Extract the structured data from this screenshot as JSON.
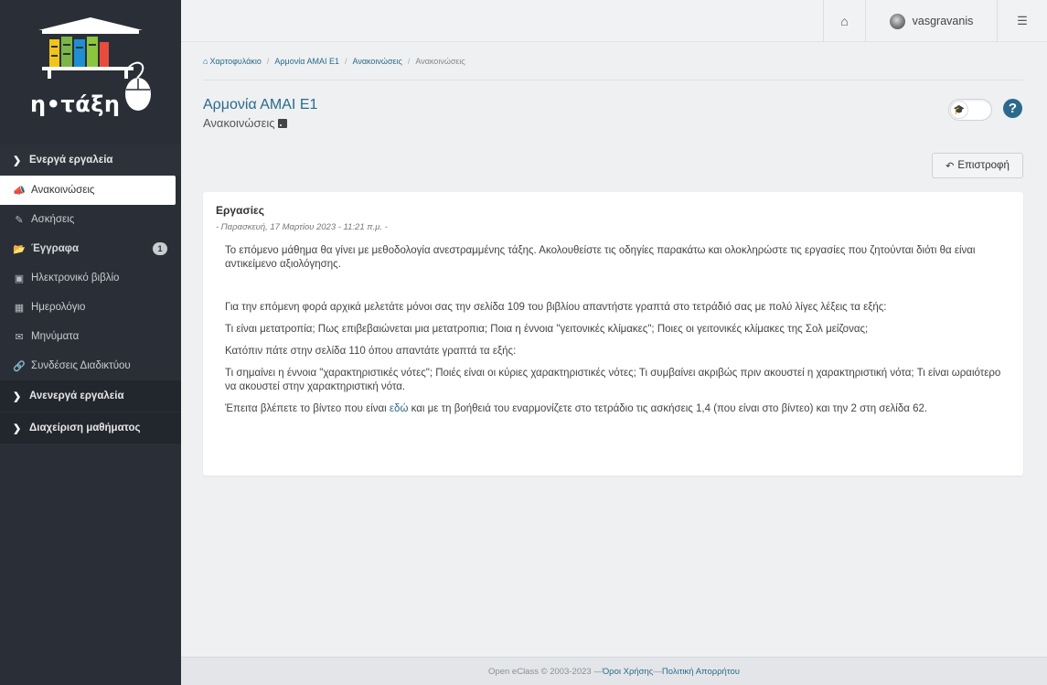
{
  "brand": {
    "logo_text": "η•τάξη"
  },
  "sidebar": {
    "active_group": "Ενεργά εργαλεία",
    "items": [
      {
        "label": "Ανακοινώσεις",
        "icon": "megaphone-icon"
      },
      {
        "label": "Ασκήσεις",
        "icon": "edit-icon"
      },
      {
        "label": "Έγγραφα",
        "icon": "folder-open-icon",
        "badge": "1"
      },
      {
        "label": "Ηλεκτρονικό βιβλίο",
        "icon": "book-icon"
      },
      {
        "label": "Ημερολόγιο",
        "icon": "calendar-icon"
      },
      {
        "label": "Μηνύματα",
        "icon": "envelope-icon"
      },
      {
        "label": "Συνδέσεις Διαδικτύου",
        "icon": "link-icon"
      }
    ],
    "inactive_group": "Ανενεργά εργαλεία",
    "admin_group": "Διαχείριση μαθήματος"
  },
  "topbar": {
    "username": "vasgravanis"
  },
  "breadcrumb": [
    "Χαρτοφυλάκιο",
    "Αρμονία ΑΜΑΙ Ε1",
    "Ανακοινώσεις",
    "Ανακοινώσεις"
  ],
  "page": {
    "title": "Αρμονία ΑΜΑΙ Ε1",
    "subtitle": "Ανακοινώσεις",
    "back_label": "Επιστροφή"
  },
  "announcement": {
    "title": "Εργασίες",
    "date": "- Παρασκευή, 17 Μαρτίου 2023 - 11:21 π.μ. -",
    "p1": "Το επόμενο μάθημα θα γίνει με μεθοδολογία ανεστραμμένης τάξης. Ακολουθείστε τις οδηγίες παρακάτω και ολοκληρώστε τις εργασίες που ζητούνται διότι θα είναι αντικείμενο αξιολόγησης.",
    "p2": "Για την επόμενη φορά αρχικά μελετάτε μόνοι σας την σελίδα 109 του βιβλίου απαντήστε γραπτά στο τετράδιό σας με πολύ λίγες λέξεις τα εξής:",
    "p3": "Τι είναι μετατροπία; Πως επιβεβαιώνεται μια μετατροπια; Ποια η έννοια \"γειτονικές κλίμακες\"; Ποιες οι γειτονικές κλίμακες της Σολ μείζονας;",
    "p4": "Κατόπιν πάτε στην σελίδα 110 όπου απαντάτε γραπτά τα εξής:",
    "p5": "Τι σημαίνει η έννοια \"χαρακτηριστικές νότες\"; Ποιές είναι οι κύριες χαρακτηριστικές νότες; Τι συμβαίνει ακριβώς πριν ακουστεί η χαρακτηριστική νότα; Τι είναι ωραιότερο να ακουστεί στην χαρακτηριστική νότα.",
    "p6_before": "Έπειτα βλέπετε το βίντεο που είναι ",
    "p6_link": "εδώ",
    "p6_after": " και με τη βοήθειά του εναρμονίζετε στο τετράδιο τις ασκήσεις 1,4 (που είναι στο βίντεο) και την 2 στη σελίδα 62."
  },
  "footer": {
    "copyright": "Open eClass © 2003-2023 — ",
    "terms": "Όροι Χρήσης",
    "sep": "— ",
    "privacy": "Πολιτική Απορρήτου"
  }
}
